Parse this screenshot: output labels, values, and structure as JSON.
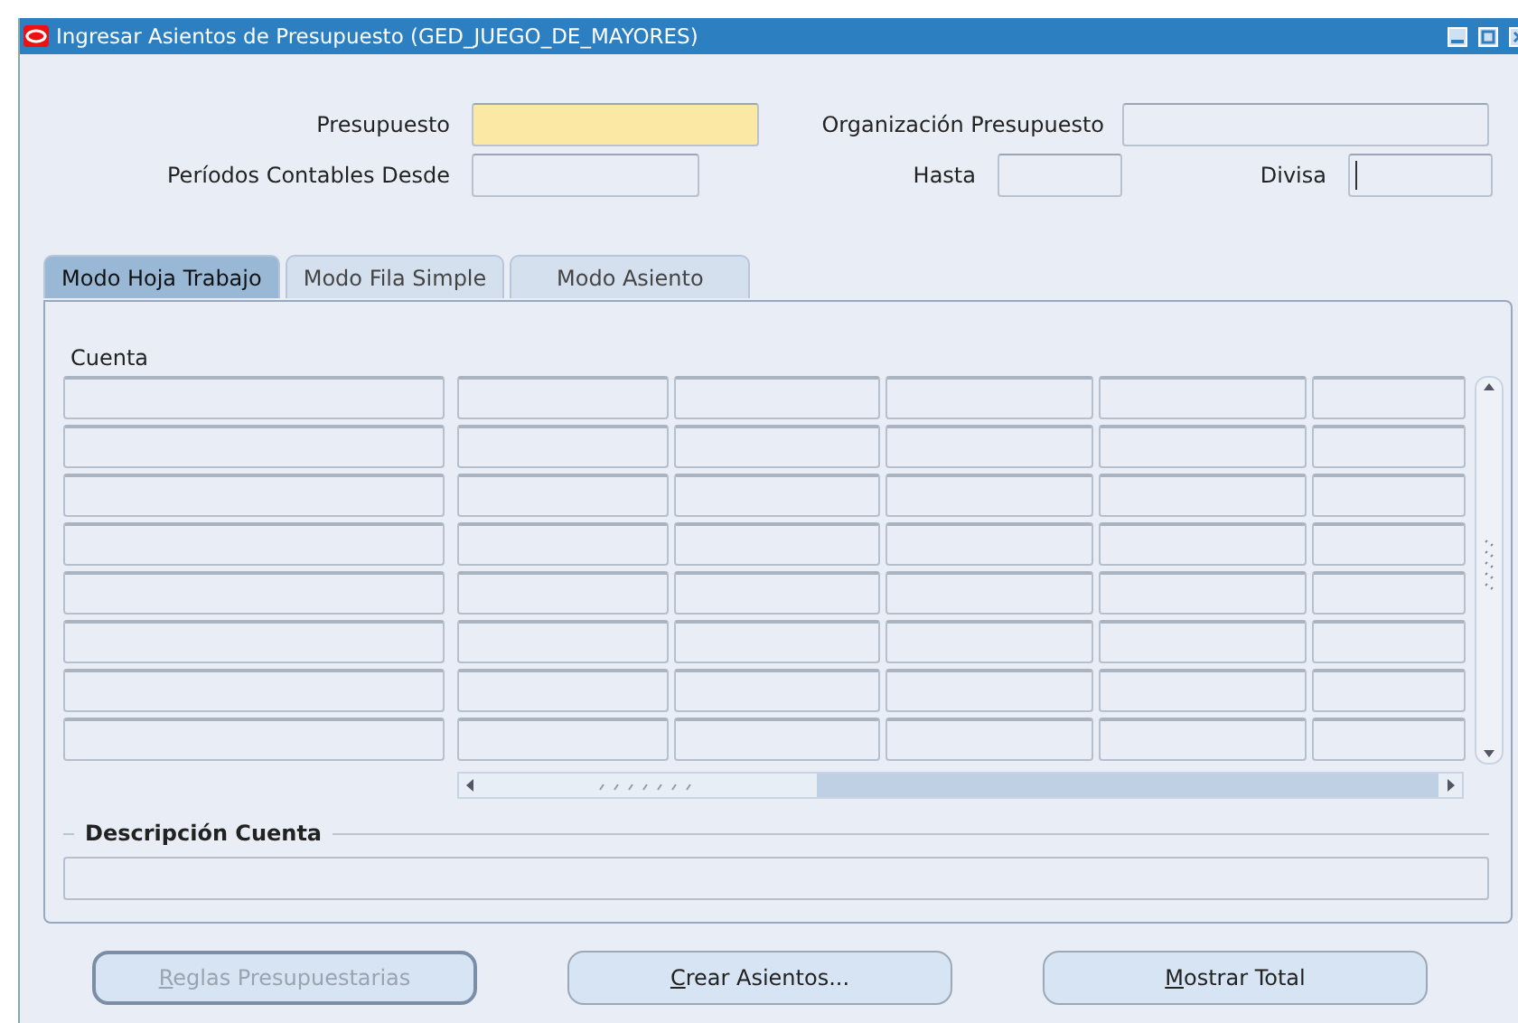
{
  "window": {
    "title": "Ingresar Asientos de Presupuesto (GED_JUEGO_DE_MAYORES)"
  },
  "header_fields": {
    "presupuesto": {
      "label": "Presupuesto",
      "required": true
    },
    "organizacion": {
      "label": "Organización Presupuesto",
      "required": false
    },
    "periodos": {
      "label": "Períodos Contables Desde",
      "required": false
    },
    "hasta": {
      "label": "Hasta",
      "required": false
    },
    "divisa": {
      "label": "Divisa",
      "required": false,
      "focused": true
    }
  },
  "tabs": [
    {
      "label": "Modo Hoja Trabajo",
      "selected": true
    },
    {
      "label": "Modo Fila Simple",
      "selected": false
    },
    {
      "label": "Modo Asiento",
      "selected": false
    }
  ],
  "grid": {
    "first_column": "Cuenta"
  },
  "description": {
    "title": "Descripción Cuenta"
  },
  "buttons": [
    {
      "label": "Reglas Presupuestarias",
      "disabled": true,
      "underline_first": true
    },
    {
      "label": "Crear Asientos...",
      "disabled": false,
      "underline_first": true
    },
    {
      "label": "Mostrar Total",
      "disabled": false,
      "underline_first": true
    }
  ]
}
